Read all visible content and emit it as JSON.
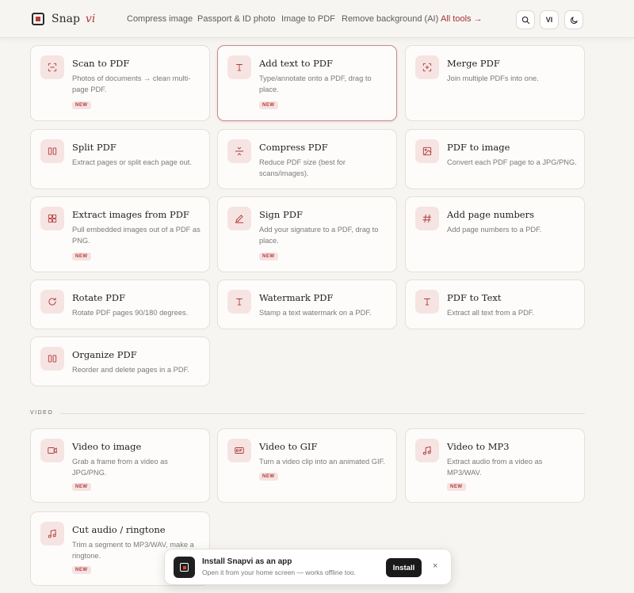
{
  "header": {
    "brand": "Snap",
    "brand_accent": "vi",
    "nav": [
      "Compress image",
      "Passport & ID photo",
      "Image to PDF",
      "Remove background (AI)",
      "All tools →"
    ],
    "lang": "VI"
  },
  "tools": [
    {
      "title": "Scan to PDF",
      "desc": "Photos of documents → clean multi-page PDF.",
      "badge": "NEW",
      "icon": "scan-icon"
    },
    {
      "title": "Add text to PDF",
      "desc": "Type/annotate onto a PDF, drag to place.",
      "badge": "NEW",
      "icon": "text-icon"
    },
    {
      "title": "Merge PDF",
      "desc": "Join multiple PDFs into one.",
      "badge": "",
      "icon": "merge-icon"
    },
    {
      "title": "Split PDF",
      "desc": "Extract pages or split each page out.",
      "badge": "",
      "icon": "split-icon"
    },
    {
      "title": "Compress PDF",
      "desc": "Reduce PDF size (best for scans/images).",
      "badge": "",
      "icon": "compress-icon"
    },
    {
      "title": "PDF to image",
      "desc": "Convert each PDF page to a JPG/PNG.",
      "badge": "",
      "icon": "image-icon"
    },
    {
      "title": "Extract images from PDF",
      "desc": "Pull embedded images out of a PDF as PNG.",
      "badge": "NEW",
      "icon": "grid-icon"
    },
    {
      "title": "Sign PDF",
      "desc": "Add your signature to a PDF, drag to place.",
      "badge": "NEW",
      "icon": "pen-icon"
    },
    {
      "title": "Add page numbers",
      "desc": "Add page numbers to a PDF.",
      "badge": "",
      "icon": "hash-icon"
    },
    {
      "title": "Rotate PDF",
      "desc": "Rotate PDF pages 90/180 degrees.",
      "badge": "",
      "icon": "rotate-icon"
    },
    {
      "title": "Watermark PDF",
      "desc": "Stamp a text watermark on a PDF.",
      "badge": "",
      "icon": "text-icon"
    },
    {
      "title": "PDF to Text",
      "desc": "Extract all text from a PDF.",
      "badge": "",
      "icon": "text-icon"
    },
    {
      "title": "Organize PDF",
      "desc": "Reorder and delete pages in a PDF.",
      "badge": "",
      "icon": "split-icon"
    }
  ],
  "video_section": {
    "label": "VIDEO",
    "tools": [
      {
        "title": "Video to image",
        "desc": "Grab a frame from a video as JPG/PNG.",
        "badge": "NEW",
        "icon": "video-icon"
      },
      {
        "title": "Video to GIF",
        "desc": "Turn a video clip into an animated GIF.",
        "badge": "NEW",
        "icon": "gif-icon"
      },
      {
        "title": "Video to MP3",
        "desc": "Extract audio from a video as MP3/WAV.",
        "badge": "NEW",
        "icon": "music-icon"
      },
      {
        "title": "Cut audio / ringtone",
        "desc": "Trim a segment to MP3/WAV, make a ringtone.",
        "badge": "NEW",
        "icon": "music-icon"
      }
    ]
  },
  "install_prompt": {
    "title": "Install Snapvi as an app",
    "subtitle": "Open it from your home screen — works offline too.",
    "button": "Install",
    "close": "×"
  }
}
